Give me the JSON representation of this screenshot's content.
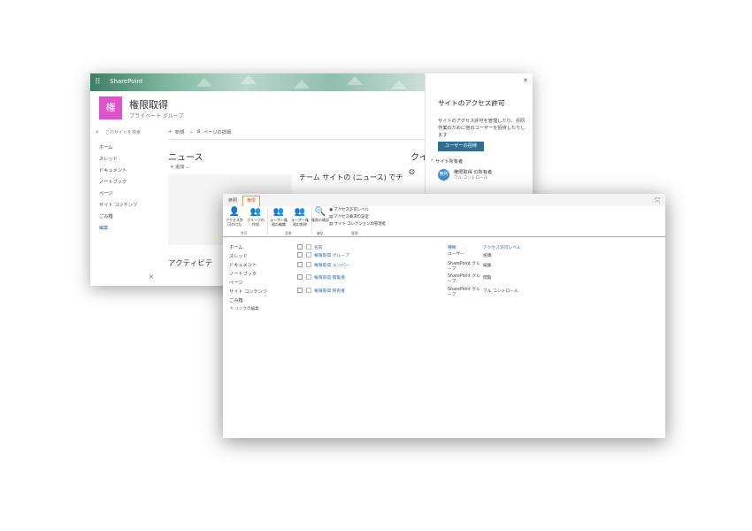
{
  "back_window": {
    "brand": "SharePoint",
    "site": {
      "logo_letter": "権",
      "title": "権限取得",
      "subtitle": "プライベート グループ"
    },
    "search_placeholder": "このサイトを検索",
    "toolbar": {
      "new_label": "新規",
      "page_details_label": "ページの詳細"
    },
    "nav": [
      "ホーム",
      "スレッド",
      "ドキュメント",
      "ノートブック",
      "ページ",
      "サイト コンテンツ",
      "ごみ箱",
      "編集"
    ],
    "news_title": "ニュース",
    "add_label": "追加",
    "team_site_text": "チーム サイトの (ニュース) でチ",
    "activity_title": "アクティビテ",
    "quick_links_title": "クイ",
    "panel": {
      "title": "サイトのアクセス許可",
      "description": "サイトのアクセス許可を管理したり、共同作業のために他のユーザーを招待したりします",
      "invite_button": "ユーザーの招待",
      "owners_label": "サイト所有者",
      "owner_avatar": "権所",
      "owner_name": "権限取得 の所有者",
      "owner_role": "フル コントロール"
    }
  },
  "front_window": {
    "tabs": [
      "参照",
      "権限"
    ],
    "ribbon": {
      "buttons": [
        {
          "label": "アクセス許可の付与"
        },
        {
          "label": "グループの作成"
        },
        {
          "label": "ユーザー権限の編集"
        },
        {
          "label": "ユーザー権限の削除"
        },
        {
          "label": "権限の確認"
        }
      ],
      "small_buttons": [
        "アクセス許可レベル",
        "アクセス要求の設定",
        "サイト コレクションの管理者"
      ],
      "groups": [
        "許可",
        "変更",
        "確認",
        "管理"
      ]
    },
    "nav": [
      "ホーム",
      "スレッド",
      "ドキュメント",
      "ノートブック",
      "ページ",
      "サイト コンテンツ",
      "ごみ箱"
    ],
    "edit_links": "リンクの編集",
    "table": {
      "headers": {
        "name": "名前",
        "type": "種類",
        "level": "アクセス許可レベル"
      },
      "rows": [
        {
          "name": "権限取得 グループ",
          "type": "ユーザー",
          "level": "投稿"
        },
        {
          "name": "権限取得 メンバー",
          "type": "SharePoint グループ",
          "level": "編集"
        },
        {
          "name": "権限取得 閲覧者",
          "type": "SharePoint グループ",
          "level": "閲覧"
        },
        {
          "name": "権限取得 所有者",
          "type": "SharePoint グループ",
          "level": "フル コントロール"
        }
      ]
    }
  }
}
